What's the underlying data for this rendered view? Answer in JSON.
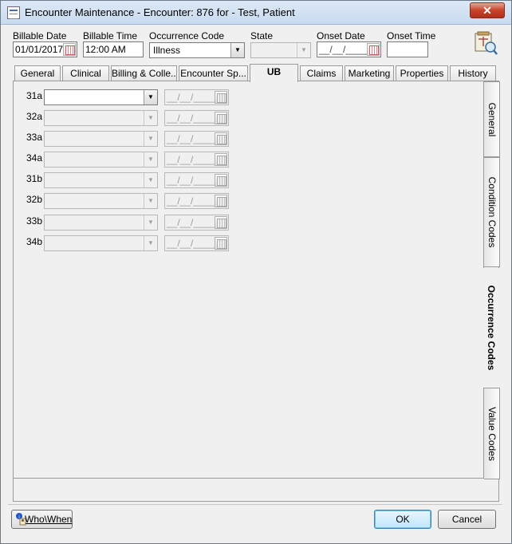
{
  "window": {
    "title": "Encounter Maintenance - Encounter: 876 for - Test, Patient",
    "close_label": "✕"
  },
  "header": {
    "billable_date": {
      "label": "Billable Date",
      "value": "01/01/2017"
    },
    "billable_time": {
      "label": "Billable Time",
      "value": "12:00 AM"
    },
    "occurrence_code": {
      "label": "Occurrence Code",
      "value": "Illness"
    },
    "state": {
      "label": "State",
      "value": ""
    },
    "onset_date": {
      "label": "Onset Date",
      "value": "__/__/____"
    },
    "onset_time": {
      "label": "Onset Time",
      "value": ""
    }
  },
  "tabs": [
    {
      "label": "General"
    },
    {
      "label": "Clinical"
    },
    {
      "label": "Billing & Colle..."
    },
    {
      "label": "Encounter  Sp..."
    },
    {
      "label": "UB",
      "active": true
    },
    {
      "label": "Claims"
    },
    {
      "label": "Marketing"
    },
    {
      "label": "Properties"
    },
    {
      "label": "History"
    }
  ],
  "side_tabs": [
    {
      "label": "General"
    },
    {
      "label": "Condition Codes"
    },
    {
      "label": "Occurrence Codes",
      "active": true
    },
    {
      "label": "Value Codes"
    }
  ],
  "occurrence_rows": [
    {
      "label": "31a",
      "code": "",
      "date": "__/__/____",
      "enabled": true
    },
    {
      "label": "32a",
      "code": "",
      "date": "__/__/____",
      "enabled": false
    },
    {
      "label": "33a",
      "code": "",
      "date": "__/__/____",
      "enabled": false
    },
    {
      "label": "34a",
      "code": "",
      "date": "__/__/____",
      "enabled": false
    },
    {
      "label": "31b",
      "code": "",
      "date": "__/__/____",
      "enabled": false
    },
    {
      "label": "32b",
      "code": "",
      "date": "__/__/____",
      "enabled": false
    },
    {
      "label": "33b",
      "code": "",
      "date": "__/__/____",
      "enabled": false
    },
    {
      "label": "34b",
      "code": "",
      "date": "__/__/____",
      "enabled": false
    }
  ],
  "footer": {
    "who_when_label": "Who\\When",
    "ok_label": "OK",
    "cancel_label": "Cancel"
  }
}
